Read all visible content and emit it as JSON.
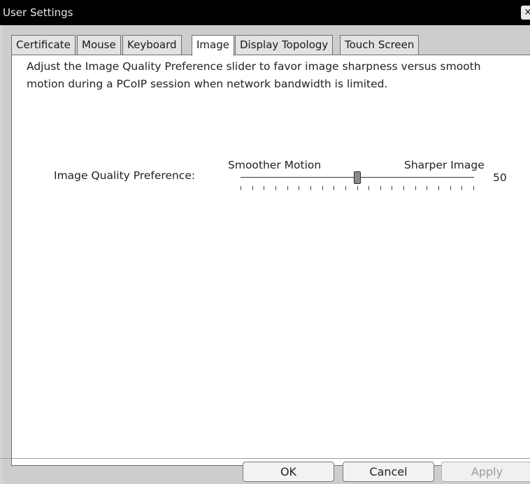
{
  "window": {
    "title": "User Settings",
    "close_glyph": "×"
  },
  "tabs": [
    {
      "label": "Certificate",
      "active": false
    },
    {
      "label": "Mouse",
      "active": false
    },
    {
      "label": "Keyboard",
      "active": false
    },
    {
      "label": "Image",
      "active": true
    },
    {
      "label": "Display Topology",
      "active": false
    },
    {
      "label": "Touch Screen",
      "active": false
    }
  ],
  "image_panel": {
    "description": "Adjust the Image Quality Preference slider to favor image sharpness versus smooth motion during a PCoIP session when network bandwidth is limited.",
    "preference_label": "Image Quality Preference:",
    "min_label": "Smoother Motion",
    "max_label": "Sharper Image",
    "value": "50",
    "slider": {
      "min": 0,
      "max": 100,
      "value": 50
    }
  },
  "buttons": {
    "ok": "OK",
    "cancel": "Cancel",
    "apply": "Apply"
  },
  "icons": {
    "close": "close-icon"
  }
}
